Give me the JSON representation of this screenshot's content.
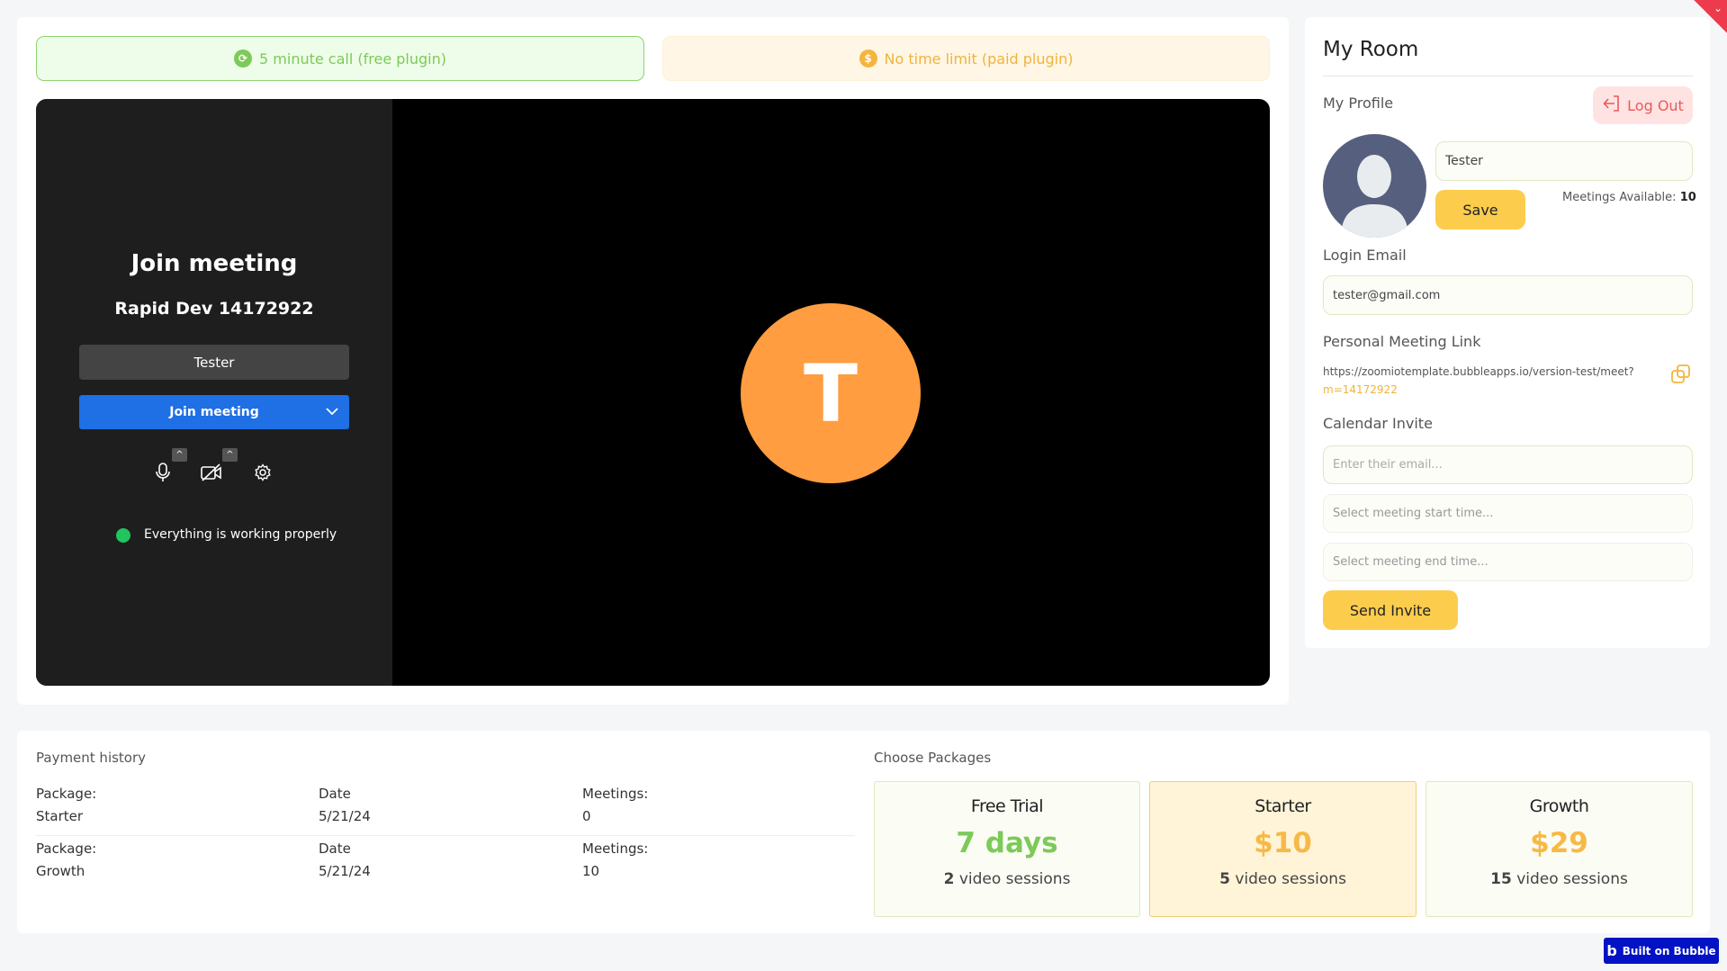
{
  "plugins": {
    "free_label": "5 minute call (free plugin)",
    "paid_label": "No time limit (paid plugin)"
  },
  "meeting": {
    "title": "Join meeting",
    "meeting_name": "Rapid Dev 14172922",
    "name_value": "Tester",
    "join_label": "Join meeting",
    "status_text": "Everything is working properly",
    "avatar_initial": "T"
  },
  "room": {
    "title": "My Room",
    "profile_label": "My Profile",
    "logout_label": "Log Out",
    "name_value": "Tester",
    "save_label": "Save",
    "meetings_available_label": "Meetings Available:",
    "meetings_available_value": "10",
    "login_email_label": "Login Email",
    "email_value": "tester@gmail.com",
    "personal_link_label": "Personal Meeting Link",
    "link_base": "https://zoomiotemplate.bubbleapps.io/version-test/meet?",
    "link_param": "m=14172922",
    "calendar_label": "Calendar Invite",
    "email_placeholder": "Enter their email...",
    "start_placeholder": "Select meeting start time...",
    "end_placeholder": "Select meeting end time...",
    "send_label": "Send Invite"
  },
  "payment": {
    "title": "Payment history",
    "rows": [
      {
        "package_label": "Package:",
        "package": "Starter",
        "date_label": "Date",
        "date": "5/21/24",
        "meetings_label": "Meetings:",
        "meetings": "0"
      },
      {
        "package_label": "Package:",
        "package": "Growth",
        "date_label": "Date",
        "date": "5/21/24",
        "meetings_label": "Meetings:",
        "meetings": "10"
      }
    ]
  },
  "packages": {
    "title": "Choose Packages",
    "items": [
      {
        "name": "Free Trial",
        "price": "7 days",
        "count": "2",
        "sessions": "video sessions"
      },
      {
        "name": "Starter",
        "price": "$10",
        "count": "5",
        "sessions": "video sessions"
      },
      {
        "name": "Growth",
        "price": "$29",
        "count": "15",
        "sessions": "video sessions"
      }
    ]
  },
  "badge": {
    "label": "Built on Bubble"
  },
  "colors": {
    "accent_yellow": "#fccc4d",
    "join_blue": "#1f6fe5",
    "avatar_orange": "#ff9d40",
    "free_green": "#7cca58",
    "price_orange": "#f7b946",
    "status_green": "#21c45d",
    "logout_red": "#e85a5a"
  }
}
